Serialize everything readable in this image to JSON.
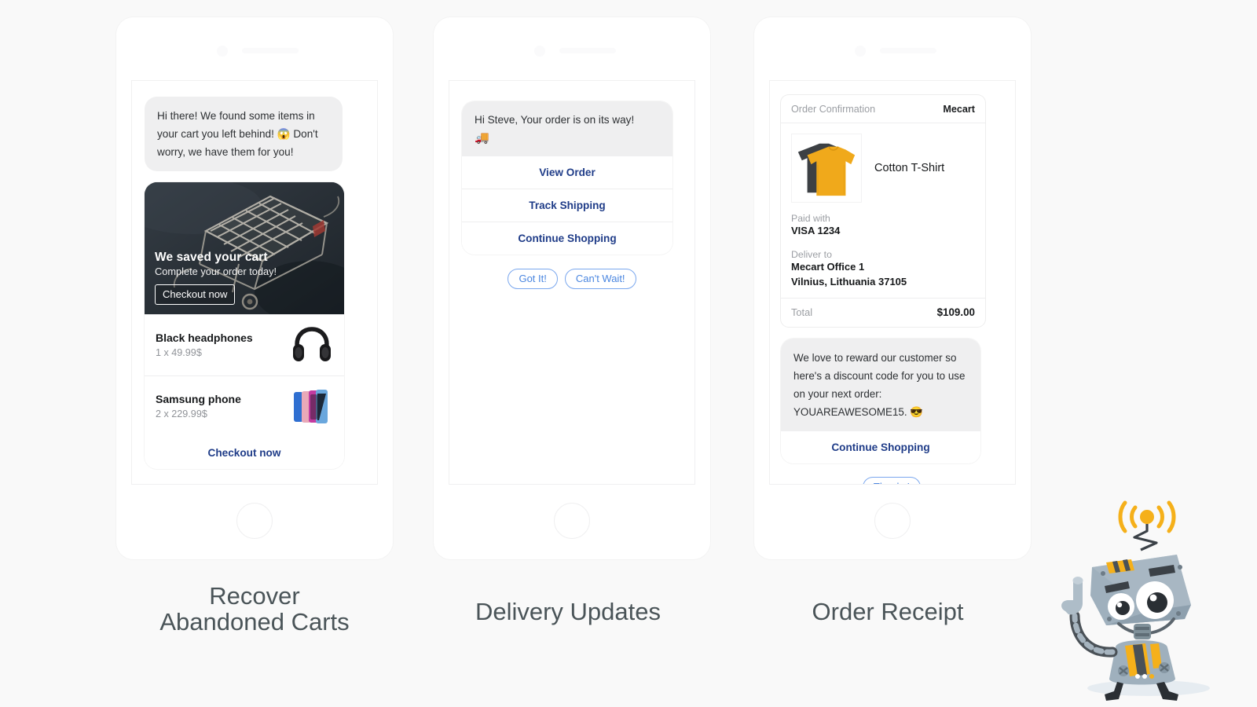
{
  "theme": {
    "background": "#f9f9f9",
    "bubble_grey": "#efeff0",
    "link_blue": "#1f3c88",
    "quick_reply_blue": "#4a86e0",
    "caption_grey": "#4a5458",
    "shirt_yellow": "#f0a91b"
  },
  "panels": [
    {
      "caption_line1": "Recover",
      "caption_line2": "Abandoned Carts",
      "greeting": "Hi there! We found some items in your cart you left behind! 😱 Don't worry, we have them for you!",
      "hero": {
        "title": "We saved your cart",
        "subtitle": "Complete your order today!",
        "button": "Checkout now",
        "image_alt": "abandoned-shopping-cart-photo"
      },
      "products": [
        {
          "name": "Black headphones",
          "qty_price": "1 x 49.99$",
          "thumb": "black-headphones-icon"
        },
        {
          "name": "Samsung phone",
          "qty_price": "2 x 229.99$",
          "thumb": "samsung-phones-icon"
        }
      ],
      "footer_action": "Checkout now"
    },
    {
      "caption_line1": "Delivery Updates",
      "caption_line2": "",
      "message": "Hi Steve, Your order is on its way!",
      "message_emoji": "🚚",
      "actions": [
        "View Order",
        "Track Shipping",
        "Continue Shopping"
      ],
      "quick_replies": [
        "Got It!",
        "Can't Wait!"
      ]
    },
    {
      "caption_line1": "Order Receipt",
      "caption_line2": "",
      "receipt": {
        "header_left": "Order Confirmation",
        "header_right": "Mecart",
        "product_name": "Cotton T-Shirt",
        "product_image_alt": "cotton-tshirt-photo",
        "paid_with_label": "Paid with",
        "paid_with_value": "VISA 1234",
        "deliver_to_label": "Deliver to",
        "deliver_to_line1": "Mecart Office 1",
        "deliver_to_line2": "Vilnius, Lithuania 37105",
        "total_label": "Total",
        "total_value": "$109.00"
      },
      "reward_message": "We love to reward our customer so here's a discount code for you to use on your next order: YOUAREAWESOME15. 😎",
      "reward_action": "Continue Shopping",
      "quick_replies": [
        "Thanks!"
      ],
      "scrollbar": {
        "up": "▲",
        "down": "▼"
      }
    }
  ],
  "mascot": {
    "name": "mecart-robot-mascot"
  }
}
